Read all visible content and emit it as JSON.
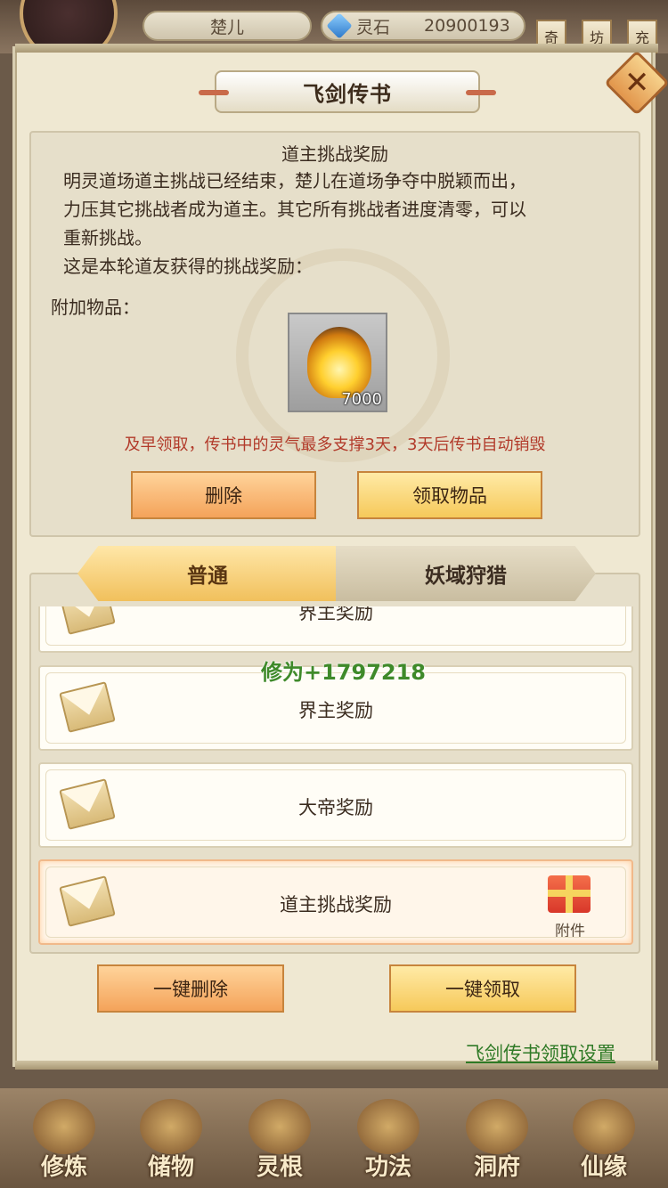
{
  "hud": {
    "player_name": "楚儿",
    "currency_label": "灵石",
    "currency_value": "20900193",
    "tags": [
      "奇",
      "坊",
      "充"
    ]
  },
  "dialog": {
    "title": "飞剑传书",
    "close_icon": "close-icon"
  },
  "mail": {
    "title": "道主挑战奖励",
    "body": "明灵道场道主挑战已经结束，楚儿在道场争夺中脱颖而出，\n力压其它挑战者成为道主。其它所有挑战者进度清零，可以\n重新挑战。\n这是本轮道友获得的挑战奖励：",
    "attachments_label": "附加物品：",
    "item": {
      "icon": "flame-orb-icon",
      "count": "7000"
    },
    "warning": "及早领取，传书中的灵气最多支撑3天，3天后传书自动销毁",
    "delete_label": "删除",
    "claim_label": "领取物品"
  },
  "tabs": [
    {
      "label": "普通",
      "active": true
    },
    {
      "label": "妖域狩猎",
      "active": false
    }
  ],
  "mail_list": [
    {
      "title": "界主奖励",
      "partial": true
    },
    {
      "title": "界主奖励"
    },
    {
      "title": "大帝奖励"
    },
    {
      "title": "道主挑战奖励",
      "selected": true,
      "attachment_label": "附件"
    }
  ],
  "floating_text": "修为+1797218",
  "actions": {
    "delete_all_label": "一键删除",
    "claim_all_label": "一键领取",
    "settings_link": "飞剑传书领取设置"
  },
  "bottom_nav": [
    {
      "label": "修炼"
    },
    {
      "label": "储物"
    },
    {
      "label": "灵根"
    },
    {
      "label": "功法"
    },
    {
      "label": "洞府"
    },
    {
      "label": "仙缘"
    }
  ],
  "colors": {
    "warning": "#b23a2a",
    "link": "#2f7a26",
    "floating_text": "#3f8a2a",
    "button_orange": "#f4a35a",
    "button_yellow": "#f6c95a"
  }
}
